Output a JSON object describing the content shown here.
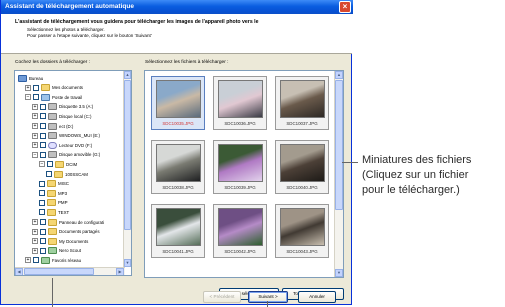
{
  "window": {
    "title": "Assistant de téléchargement automatique",
    "close_glyph": "×"
  },
  "header": {
    "line1": "L'assistant de téléchargement vous guidera pour télécharger les images de l'appareil photo vers le",
    "line2": "Sélectionnez les photos a télécharger.",
    "line3": "Pour passer a l'etape suivante, cliquez sur le bouton 'Suivant'"
  },
  "tree": {
    "label": "Cochez les dossiers à télécharger :",
    "items": [
      {
        "label": "Bureau",
        "icon": "desktop-icon"
      },
      {
        "label": "Mes documents",
        "icon": "folder-icon"
      },
      {
        "label": "Poste de travail",
        "icon": "computer-icon"
      },
      {
        "label": "Disquette 3.5 (A:)",
        "icon": "floppy-icon"
      },
      {
        "label": "Disque local (C:)",
        "icon": "drive-icon"
      },
      {
        "label": "ect (D:)",
        "icon": "drive-icon"
      },
      {
        "label": "WINDOWS_MUI (E:)",
        "icon": "drive-icon"
      },
      {
        "label": "Lecteur DVD (F:)",
        "icon": "dvd-icon"
      },
      {
        "label": "Disque amovible (G:)",
        "icon": "drive-icon"
      },
      {
        "label": "DCIM",
        "icon": "folder-icon"
      },
      {
        "label": "100SSCAM",
        "icon": "folder-icon"
      },
      {
        "label": "MISC",
        "icon": "folder-icon"
      },
      {
        "label": "MP3",
        "icon": "folder-icon"
      },
      {
        "label": "PMP",
        "icon": "folder-icon"
      },
      {
        "label": "TEXT",
        "icon": "folder-icon"
      },
      {
        "label": "Panneau de configurati",
        "icon": "folder-icon"
      },
      {
        "label": "Documents partagés",
        "icon": "folder-icon"
      },
      {
        "label": "My Documents",
        "icon": "folder-icon"
      },
      {
        "label": "Nero Scout",
        "icon": "network-icon"
      },
      {
        "label": "Favoris réseau",
        "icon": "network-icon"
      }
    ]
  },
  "files": {
    "label": "Sélectionnez les fichiers à télécharger :",
    "thumbnails": [
      {
        "name": "SDC10035.JPG",
        "selected": true,
        "colors": [
          "#8aa9c9",
          "#c9b9a5",
          "#5a6b7c"
        ]
      },
      {
        "name": "SDC10036.JPG",
        "selected": false,
        "colors": [
          "#c9cfd6",
          "#e1c8d2",
          "#3a3b45"
        ]
      },
      {
        "name": "SDC10037.JPG",
        "selected": false,
        "colors": [
          "#c7bfb3",
          "#6a5a4b",
          "#2d2824"
        ]
      },
      {
        "name": "SDC10038.JPG",
        "selected": false,
        "colors": [
          "#d6d8d6",
          "#7a7b72",
          "#1f2022"
        ]
      },
      {
        "name": "SDC10039.JPG",
        "selected": false,
        "colors": [
          "#3b5a35",
          "#b07ac4",
          "#e2d2ec"
        ]
      },
      {
        "name": "SDC10040.JPG",
        "selected": false,
        "colors": [
          "#a39b8e",
          "#4c4037",
          "#1d1a17"
        ]
      },
      {
        "name": "SDC10041.JPG",
        "selected": false,
        "colors": [
          "#3a4e3c",
          "#e3e6e9",
          "#556d58"
        ]
      },
      {
        "name": "SDC10042.JPG",
        "selected": false,
        "colors": [
          "#6e4f84",
          "#b58bc7",
          "#2e5f2e"
        ]
      },
      {
        "name": "SDC10043.JPG",
        "selected": false,
        "colors": [
          "#9e9386",
          "#413a33",
          "#c9bfb0"
        ]
      }
    ],
    "select_all": "Tout sélectionner",
    "deselect_all": "Tout désélectionner"
  },
  "nav": {
    "prev": "< Précédent",
    "next": "Suivant >",
    "cancel": "Annuler"
  },
  "callout": {
    "line1": "Miniatures des fichiers",
    "line2": "(Cliquez sur un fichier",
    "line3": "pour le télécharger.)"
  }
}
